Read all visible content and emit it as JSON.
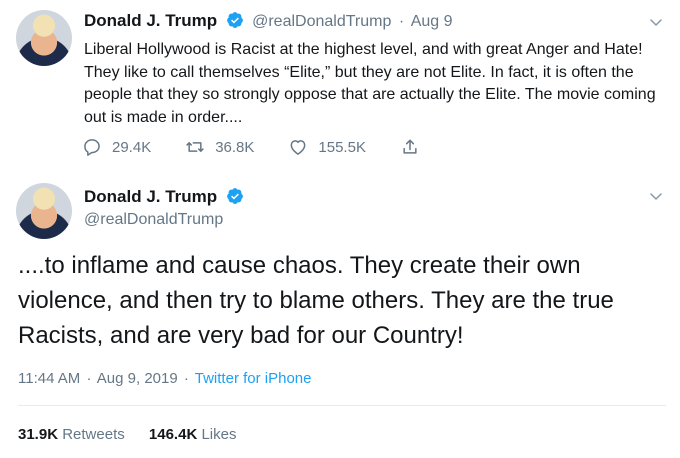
{
  "tweet1": {
    "display_name": "Donald J. Trump",
    "handle": "@realDonaldTrump",
    "separator": "·",
    "date": "Aug 9",
    "text": "Liberal Hollywood is Racist at the highest level, and with great Anger and Hate! They like to call themselves “Elite,” but they are not Elite. In fact, it is often the people that they so strongly oppose that are actually the Elite. The movie coming out is made in order....",
    "replies": "29.4K",
    "retweets": "36.8K",
    "likes": "155.5K",
    "icons": [
      "reply-icon",
      "retweet-icon",
      "like-icon",
      "share-icon",
      "chevron-down-icon",
      "verified-icon"
    ]
  },
  "tweet2": {
    "display_name": "Donald J. Trump",
    "handle": "@realDonaldTrump",
    "text": "....to inflame and cause chaos. They create their own violence, and then try to blame others. They are the true Racists, and are very bad for our Country!",
    "time": "11:44 AM",
    "separator": "·",
    "date": "Aug 9, 2019",
    "separator2": "·",
    "source": "Twitter for iPhone",
    "retweet_count": "31.9K",
    "retweet_label": "Retweets",
    "like_count": "146.4K",
    "like_label": "Likes"
  },
  "colors": {
    "verified": "#1da1f2",
    "muted": "#657786",
    "link": "#1da1f2",
    "text": "#14171a"
  }
}
